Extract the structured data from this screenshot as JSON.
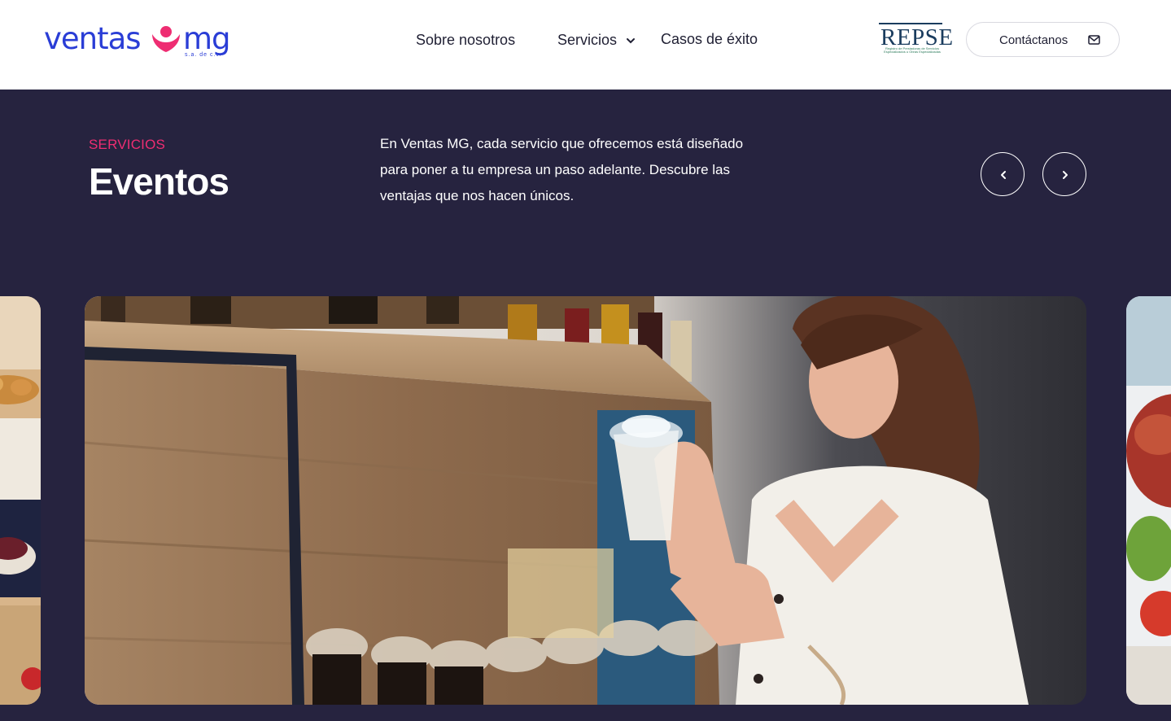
{
  "header": {
    "logo": {
      "word_left": "ventas",
      "word_right": "mg",
      "subtitle": "s.a. de c.v.",
      "heart_color": "#ee2d72",
      "brand_color": "#2a3dd6"
    },
    "nav": {
      "about": "Sobre nosotros",
      "services": "Servicios",
      "cases": "Casos de éxito"
    },
    "repse": {
      "title": "REPSE",
      "subtitle": "Registro de Prestadoras de Servicios Especializados u Obras Especializadas"
    },
    "contact_label": "Contáctanos"
  },
  "hero": {
    "eyebrow": "SERVICIOS",
    "title": "Eventos",
    "description": "En Ventas MG, cada servicio que ofrecemos está diseñado para poner a tu empresa un paso adelante. Descubre las ventajas que nos hacen únicos."
  },
  "carousel": {
    "prev_icon": "chevron-left-icon",
    "next_icon": "chevron-right-icon",
    "slides": [
      "pastries-photo",
      "woman-shopping-photo",
      "food-photo"
    ]
  },
  "colors": {
    "background": "#26233f",
    "accent": "#ee2d72",
    "brand": "#2a3dd6"
  }
}
